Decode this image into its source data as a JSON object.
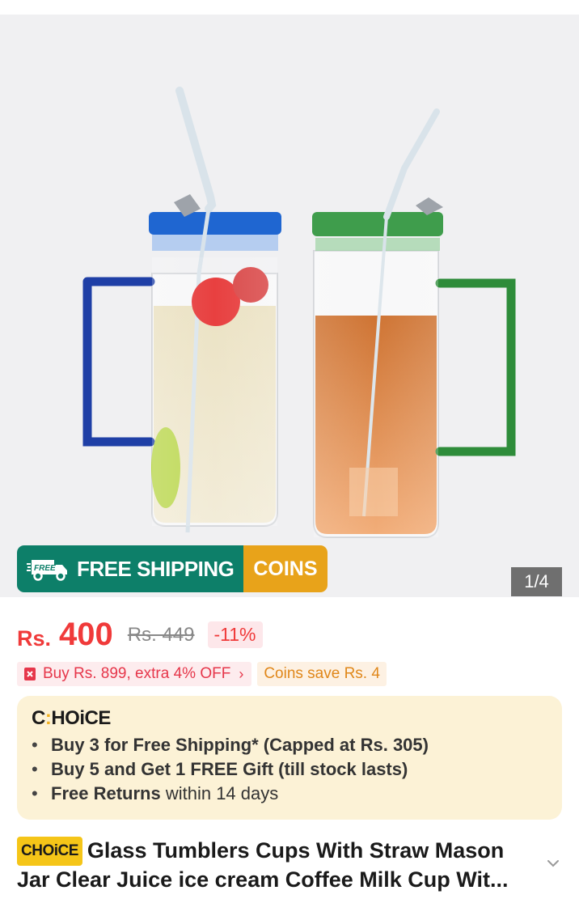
{
  "gallery": {
    "image_alt": "Two glass tumblers with straws, blue and green lids",
    "page_indicator": "1/4"
  },
  "banner": {
    "free_badge": "FREE",
    "shipping_text": "FREE SHIPPING",
    "coins_text": "COINS",
    "colors": {
      "shipping_bg": "#0d7f69",
      "coins_bg": "#e8a31a"
    }
  },
  "price": {
    "currency": "Rs.",
    "value": "400",
    "original": "Rs. 449",
    "discount": "-11%",
    "color": "#f03a3a"
  },
  "promos": {
    "buy_offer": "Buy Rs. 899, extra 4% OFF",
    "buy_chevron": "›",
    "coins_save": "Coins save Rs. 4"
  },
  "choice": {
    "logo_prefix": "C",
    "logo_dot": ":",
    "logo_rest": "HOiCE",
    "items": [
      {
        "bold": "Buy 3 for  Free Shipping* (Capped at Rs. 305)",
        "rest": ""
      },
      {
        "bold": "Buy 5 and Get 1 FREE Gift (till stock lasts)",
        "rest": ""
      },
      {
        "bold": "Free Returns",
        "rest": " within 14 days"
      }
    ]
  },
  "product": {
    "choice_tag": "CHOiCE",
    "title_line1": "Glass Tumblers Cups With Straw Mason",
    "title_line2": "Jar Clear Juice ice cream Coffee Milk Cup Wit..."
  }
}
